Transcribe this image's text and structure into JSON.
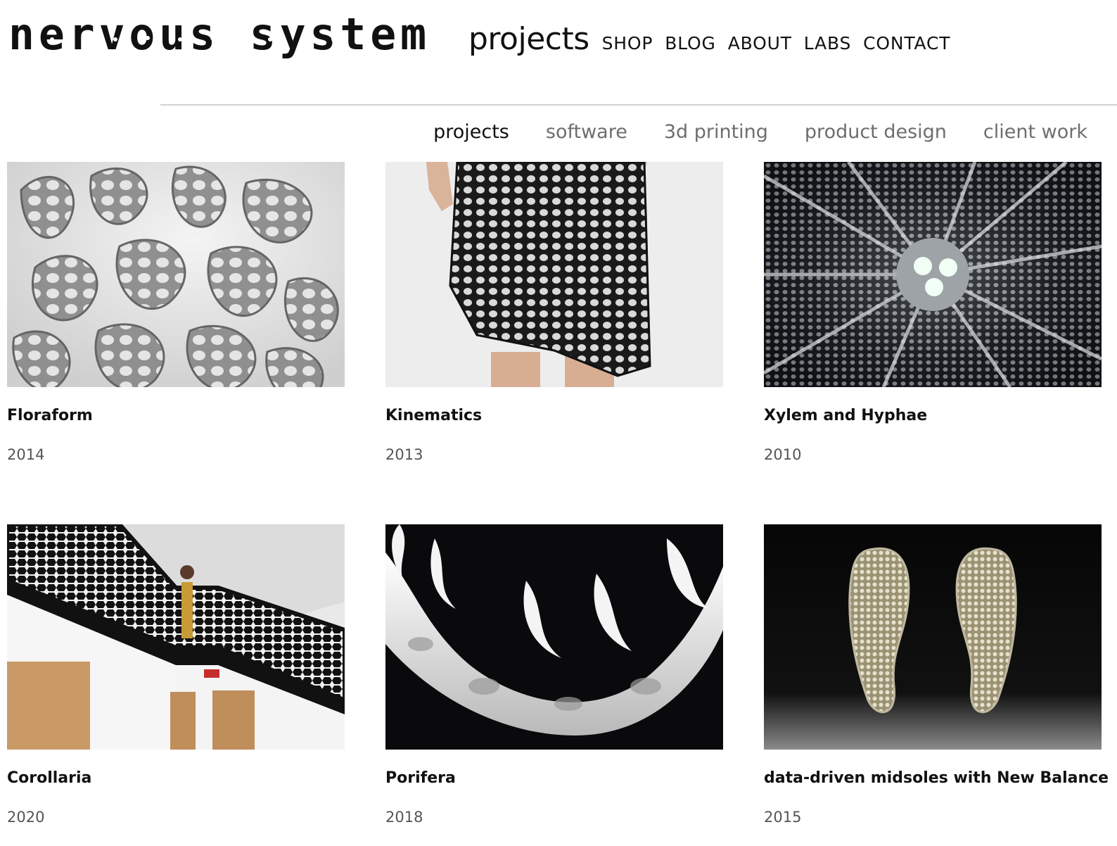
{
  "site": {
    "logo_text": "nervous system"
  },
  "nav": {
    "current": "projects",
    "links": [
      "SHOP",
      "BLOG",
      "ABOUT",
      "LABS",
      "CONTACT"
    ]
  },
  "subnav": {
    "items": [
      "projects",
      "software",
      "3d printing",
      "product design",
      "client work"
    ],
    "active": "projects"
  },
  "projects": [
    {
      "title": "Floraform",
      "year": "2014",
      "image": "white-lattice-sculpture"
    },
    {
      "title": "Kinematics",
      "year": "2013",
      "image": "black-lattice-dress"
    },
    {
      "title": "Xylem and Hyphae",
      "year": "2010",
      "image": "radial-lattice-lamp"
    },
    {
      "title": "Corollaria",
      "year": "2020",
      "image": "lattice-stair-railing"
    },
    {
      "title": "Porifera",
      "year": "2018",
      "image": "white-porcelain-necklace"
    },
    {
      "title": "data-driven midsoles with New Balance",
      "year": "2015",
      "image": "lattice-midsoles"
    }
  ],
  "colors": {
    "text": "#111111",
    "muted": "#6e6e6e",
    "divider": "#d2d2d2",
    "background": "#ffffff"
  }
}
